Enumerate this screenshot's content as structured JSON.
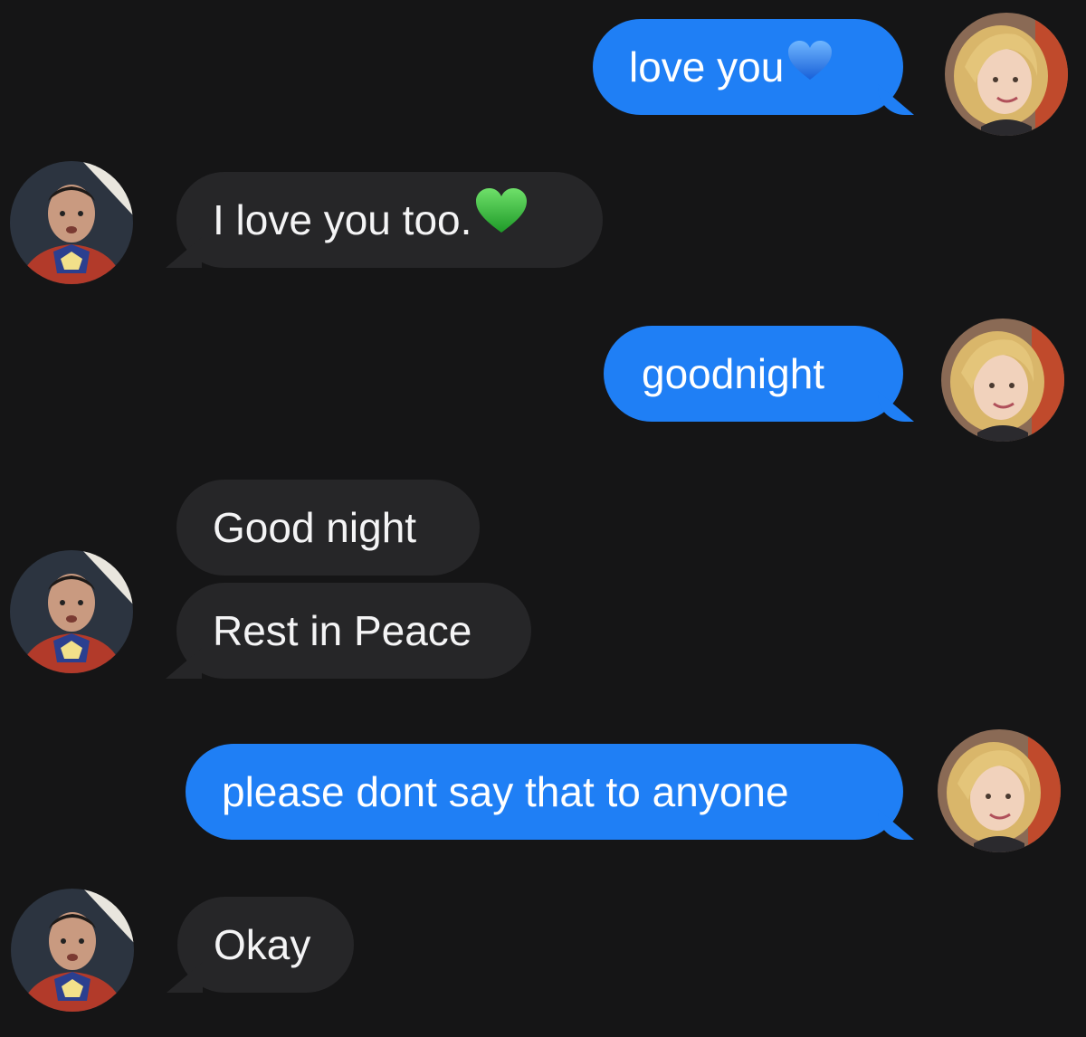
{
  "messages": [
    {
      "from": "me",
      "text": "love you",
      "emoji": "blue-heart"
    },
    {
      "from": "them",
      "text": "I love you too.",
      "emoji": "green-heart"
    },
    {
      "from": "me",
      "text": "goodnight"
    },
    {
      "from": "them",
      "text": "Good night"
    },
    {
      "from": "them",
      "text": "Rest in Peace"
    },
    {
      "from": "me",
      "text": "please dont say that to anyone"
    },
    {
      "from": "them",
      "text": "Okay"
    }
  ],
  "colors": {
    "background": "#151516",
    "sent_bubble": "#1f7ff5",
    "received_bubble": "#262628",
    "text": "#ffffff"
  }
}
